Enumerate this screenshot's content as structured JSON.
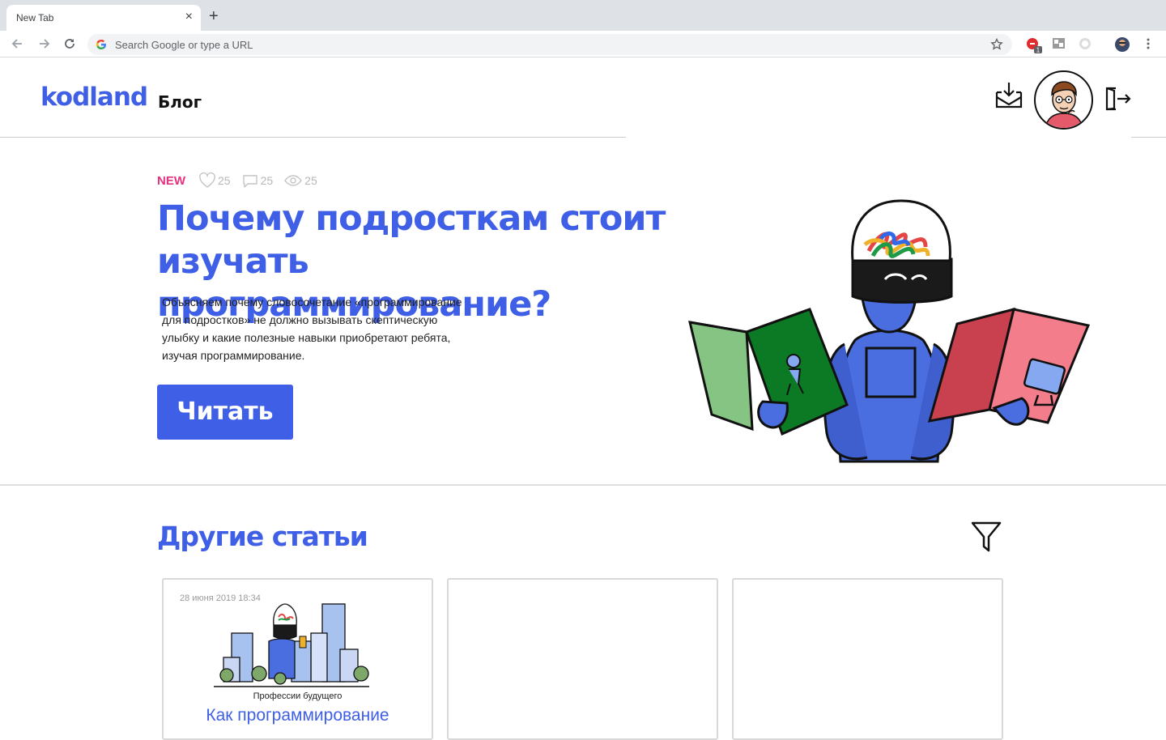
{
  "browser": {
    "tab_title": "New Tab",
    "new_tab_symbol": "+",
    "close_symbol": "×",
    "omnibox_placeholder": "Search Google or type a URL",
    "extension_badge": "1"
  },
  "header": {
    "logo": "kodland",
    "section": "Блог"
  },
  "hero": {
    "badge": "NEW",
    "likes": "25",
    "comments": "25",
    "views": "25",
    "title_line1": "Почему подросткам стоит",
    "title_line2": "изучать программирование?",
    "description": "Объясняем почему словосочетание «программирование для подростков» не должно вызывать скептическую улыбку и какие полезные навыки приобретают ребята, изучая программирование.",
    "button_label": "Читать"
  },
  "articles": {
    "section_title": "Другие статьи",
    "cards": [
      {
        "date": "28 июня 2019 18:34",
        "category": "Профессии будущего",
        "title": "Как программирование"
      }
    ]
  },
  "colors": {
    "brand_blue": "#3f5fe6",
    "new_badge": "#e5317f",
    "book_green": "#0c7a24",
    "book_red": "#c9414f"
  },
  "icons": [
    "back-arrow-icon",
    "forward-arrow-icon",
    "reload-icon",
    "google-icon",
    "star-icon",
    "inbox-download-icon",
    "logout-icon",
    "heart-icon",
    "comment-icon",
    "eye-icon",
    "filter-icon"
  ]
}
